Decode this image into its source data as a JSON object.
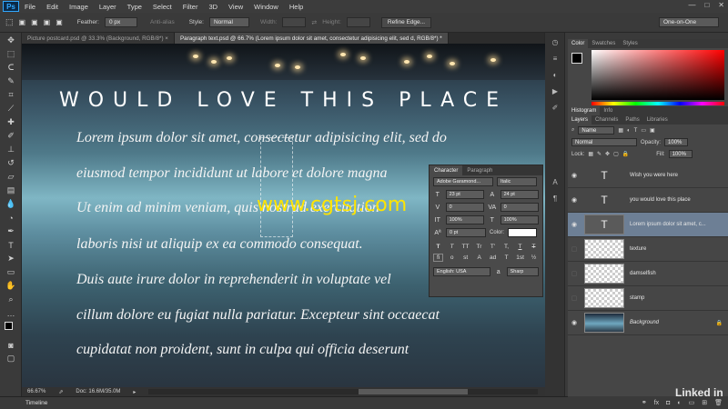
{
  "menubar": {
    "logo": "Ps",
    "items": [
      "File",
      "Edit",
      "Image",
      "Layer",
      "Type",
      "Select",
      "Filter",
      "3D",
      "View",
      "Window",
      "Help"
    ]
  },
  "options": {
    "feather_label": "Feather:",
    "feather_value": "0 px",
    "antialias_label": "Anti-alias",
    "style_label": "Style:",
    "style_value": "Normal",
    "width_label": "Width:",
    "height_label": "Height:",
    "refine_edge": "Refine Edge...",
    "workspace": "One-on-One"
  },
  "tabs": [
    {
      "label": "Picture postcard.psd @ 33.3% (Background, RGB/8*) ×"
    },
    {
      "label": "Paragraph text.psd @ 66.7% (Lorem ipsum dolor sit amet, consectetur adipisicing elit, sed d, RGB/8*) *"
    }
  ],
  "canvas": {
    "title": "WOULD LOVE THIS PLACE",
    "lines": [
      "Lorem ipsum dolor sit amet, consectetur adipisicing elit, sed do",
      "eiusmod tempor incididunt ut labore et dolore magna",
      "Ut enim ad minim veniam, quis nostrud exercitation",
      "laboris nisi ut aliquip ex ea commodo consequat.",
      "Duis aute irure dolor in reprehenderit in voluptate vel",
      "cillum dolore eu fugiat nulla pariatur. Excepteur sint occaecat",
      "cupidatat non proident, sunt in culpa qui officia deserunt"
    ],
    "watermark": "www.cgtsj.com"
  },
  "status": {
    "zoom": "66.67%",
    "doc": "Doc: 16.6M/35.0M"
  },
  "timeline": "Timeline",
  "character": {
    "tabs": [
      "Character",
      "Paragraph"
    ],
    "font_family": "Adobe Garamond...",
    "font_style": "Italic",
    "size": "23 pt",
    "leading": "24 pt",
    "kerning": "0",
    "tracking": "0",
    "v_scale": "100%",
    "h_scale": "100%",
    "baseline": "0 pt",
    "color_label": "Color:",
    "language": "English: USA",
    "aa": "Sharp",
    "glyphs": [
      "T",
      "T",
      "TT",
      "Tr",
      "T'",
      "T,",
      "T",
      "T"
    ],
    "glyphs2": [
      "fi",
      "o",
      "st",
      "A",
      "ad",
      "T",
      "1st",
      "½"
    ]
  },
  "color_panel": {
    "tabs": [
      "Color",
      "Swatches",
      "Styles"
    ]
  },
  "hist_tabs": [
    "Histogram",
    "Info"
  ],
  "layers_panel": {
    "tabs": [
      "Layers",
      "Channels",
      "Paths",
      "Libraries"
    ],
    "kind": "Name",
    "blend": "Normal",
    "opacity_label": "Opacity:",
    "opacity": "100%",
    "lock_label": "Lock:",
    "fill_label": "Fill:",
    "fill": "100%",
    "layers": [
      {
        "name": "Wish you were here",
        "thumb": "text",
        "selected": false
      },
      {
        "name": "you would love this place",
        "thumb": "text",
        "selected": false
      },
      {
        "name": "Lorem ipsum dolor sit amet, c...",
        "thumb": "text",
        "selected": true
      },
      {
        "name": "texture",
        "thumb": "checker",
        "selected": false
      },
      {
        "name": "damselfish",
        "thumb": "checker",
        "selected": false
      },
      {
        "name": "stamp",
        "thumb": "checker",
        "selected": false
      },
      {
        "name": "Background",
        "thumb": "photo",
        "selected": false
      }
    ]
  },
  "watermark_brand": "Linked in"
}
